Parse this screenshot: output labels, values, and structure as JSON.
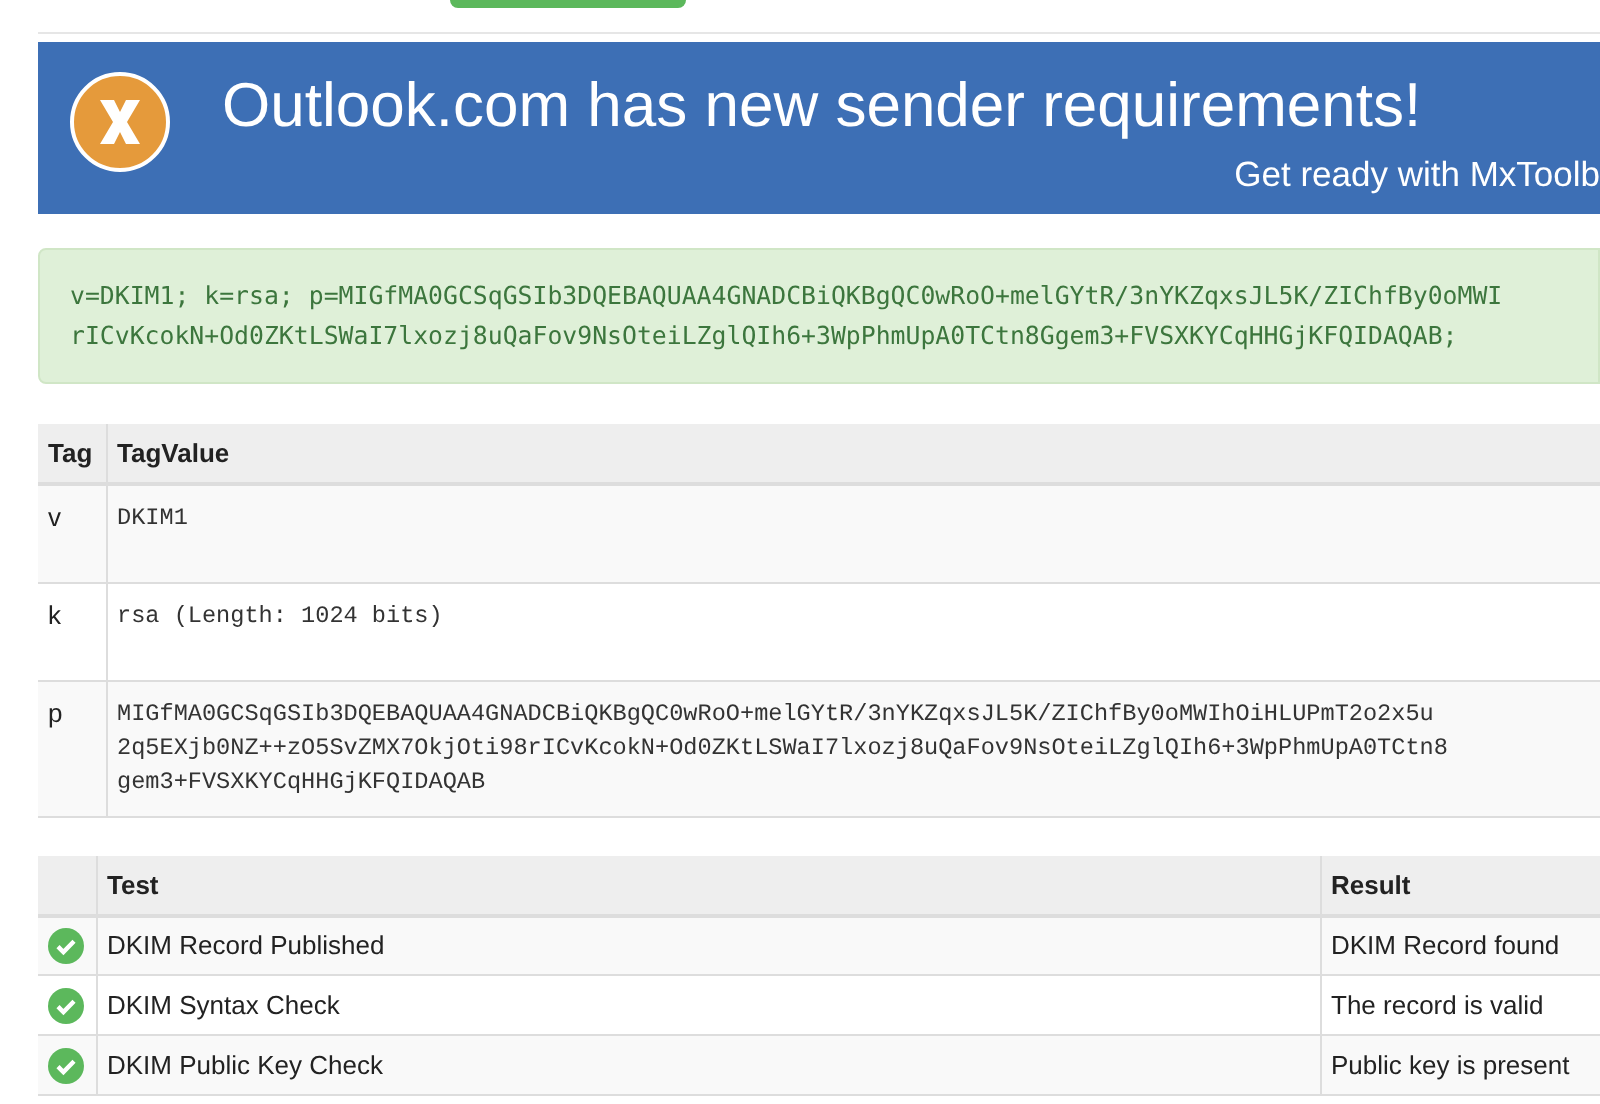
{
  "banner": {
    "title": "Outlook.com has new sender requirements!",
    "subtitle": "Get ready with MxToolb"
  },
  "record": {
    "lines": [
      "v=DKIM1; k=rsa; p=MIGfMA0GCSqGSIb3DQEBAQUAA4GNADCBiQKBgQC0wRoO+melGYtR/3nYKZqxsJL5K/ZIChfBy0oMWI",
      "rICvKcokN+Od0ZKtLSWaI7lxozj8uQaFov9NsOteiLZglQIh6+3WpPhmUpA0TCtn8Ggem3+FVSXKYCqHHGjKFQIDAQAB;"
    ]
  },
  "tag_table": {
    "columns": [
      "Tag",
      "TagValue"
    ],
    "rows": [
      {
        "tag": "v",
        "value": [
          "DKIM1"
        ]
      },
      {
        "tag": "k",
        "value": [
          "rsa (Length: 1024 bits)"
        ]
      },
      {
        "tag": "p",
        "value": [
          "MIGfMA0GCSqGSIb3DQEBAQUAA4GNADCBiQKBgQC0wRoO+melGYtR/3nYKZqxsJL5K/ZIChfBy0oMWIhOiHLUPmT2o2x5u",
          "2q5EXjb0NZ++zO5SvZMX7OkjOti98rICvKcokN+Od0ZKtLSWaI7lxozj8uQaFov9NsOteiLZglQIh6+3WpPhmUpA0TCtn8",
          "gem3+FVSXKYCqHHGjKFQIDAQAB"
        ]
      }
    ]
  },
  "test_table": {
    "columns": [
      "Test",
      "Result"
    ],
    "rows": [
      {
        "passed": true,
        "test": "DKIM Record Published",
        "result": "DKIM Record found"
      },
      {
        "passed": true,
        "test": "DKIM Syntax Check",
        "result": "The record is valid"
      },
      {
        "passed": true,
        "test": "DKIM Public Key Check",
        "result": "Public key is present"
      }
    ]
  }
}
